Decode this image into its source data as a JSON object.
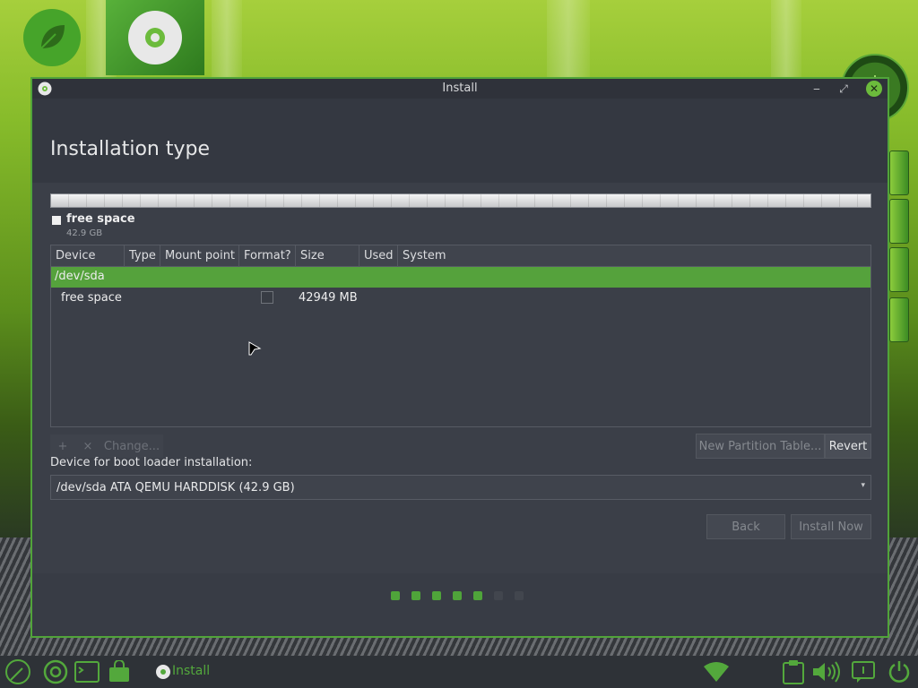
{
  "window": {
    "title": "Install",
    "minimize_glyph": "‒",
    "maximize_glyph": "⤢",
    "close_glyph": "✕"
  },
  "page": {
    "title": "Installation type"
  },
  "partition_legend": {
    "label": "free space",
    "size": "42.9 GB"
  },
  "table": {
    "columns": [
      "Device",
      "Type",
      "Mount point",
      "Format?",
      "Size",
      "Used",
      "System"
    ],
    "device_row": "/dev/sda",
    "partition_row": {
      "device": "free space",
      "size": "42949 MB"
    }
  },
  "partition_toolbar": {
    "add_glyph": "+",
    "remove_glyph": "×",
    "change_label": "Change...",
    "new_table_label": "New Partition Table...",
    "revert_label": "Revert"
  },
  "bootloader": {
    "label": "Device for boot loader installation:",
    "selected": "/dev/sda   ATA QEMU HARDDISK (42.9 GB)"
  },
  "buttons": {
    "back": "Back",
    "install_now": "Install Now"
  },
  "progress": {
    "steps_done": 5,
    "steps_total": 7
  },
  "taskbar": {
    "active_app_label": "Install"
  },
  "colors": {
    "accent": "#51a43a",
    "window_bg": "#383c45",
    "selection": "#55a23c"
  },
  "icons": [
    "leaf-icon",
    "cd-icon",
    "chrome-icon",
    "terminal-icon",
    "bag-icon",
    "wifi-icon",
    "clipboard-icon",
    "volume-icon",
    "notification-icon",
    "power-icon"
  ]
}
